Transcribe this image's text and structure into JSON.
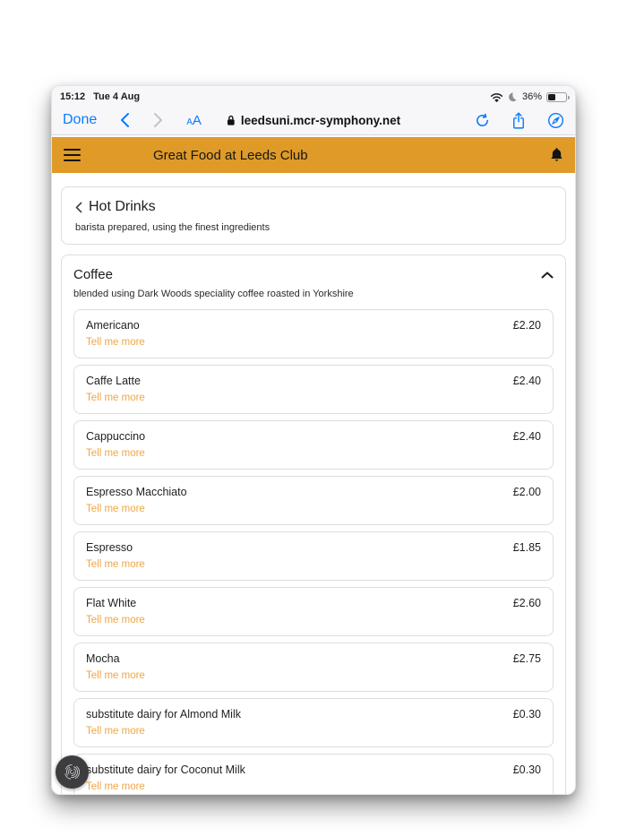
{
  "status_bar": {
    "time": "15:12",
    "date": "Tue 4 Aug",
    "battery_percent": "36%"
  },
  "browser": {
    "done_label": "Done",
    "font_size_label_small": "A",
    "font_size_label_big": "A",
    "url": "leedsuni.mcr-symphony.net"
  },
  "app_header": {
    "title": "Great Food at Leeds Club"
  },
  "page": {
    "back_label": "Hot Drinks",
    "back_subtitle": "barista prepared, using the finest ingredients",
    "section": {
      "title": "Coffee",
      "subtitle": "blended using Dark Woods speciality coffee roasted in Yorkshire",
      "items": [
        {
          "name": "Americano",
          "price": "£2.20",
          "link": "Tell me more"
        },
        {
          "name": "Caffe Latte",
          "price": "£2.40",
          "link": "Tell me more"
        },
        {
          "name": "Cappuccino",
          "price": "£2.40",
          "link": "Tell me more"
        },
        {
          "name": "Espresso Macchiato",
          "price": "£2.00",
          "link": "Tell me more"
        },
        {
          "name": "Espresso",
          "price": "£1.85",
          "link": "Tell me more"
        },
        {
          "name": "Flat White",
          "price": "£2.60",
          "link": "Tell me more"
        },
        {
          "name": "Mocha",
          "price": "£2.75",
          "link": "Tell me more"
        },
        {
          "name": "substitute dairy for Almond Milk",
          "price": "£0.30",
          "link": "Tell me more"
        },
        {
          "name": "substitute dairy for Coconut Milk",
          "price": "£0.30",
          "link": "Tell me more"
        }
      ]
    }
  },
  "colors": {
    "accent": "#DF9A28",
    "link": "#F0A643",
    "ios_blue": "#0A7AFF"
  }
}
